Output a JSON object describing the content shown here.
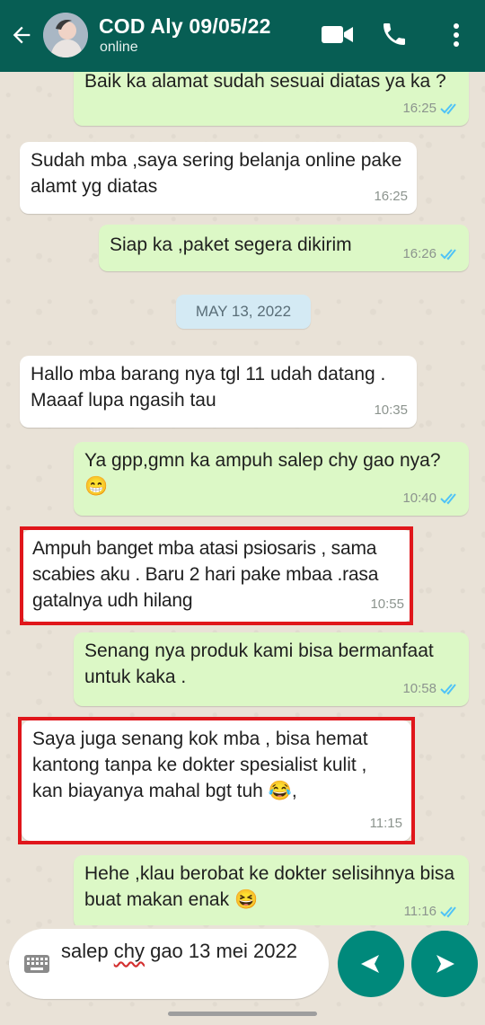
{
  "header": {
    "contact_name": "COD Aly 09/05/22",
    "status": "online",
    "bg_color": "#075e54"
  },
  "chat": {
    "date_separator": "MAY 13, 2022",
    "messages": [
      {
        "direction": "out",
        "text": "Baik ka alamat sudah sesuai diatas ya ka ?",
        "time": "16:25",
        "read": true
      },
      {
        "direction": "in",
        "text": "Sudah mba ,saya sering belanja online pake alamt yg diatas",
        "time": "16:25"
      },
      {
        "direction": "out",
        "text": "Siap ka ,paket segera dikirim",
        "time": "16:26",
        "read": true
      },
      {
        "direction": "in",
        "text": "Hallo mba barang nya tgl 11 udah datang . Maaaf lupa ngasih tau",
        "time": "10:35"
      },
      {
        "direction": "out",
        "text": "Ya gpp,gmn ka ampuh salep chy gao nya? 😁",
        "time": "10:40",
        "read": true
      },
      {
        "direction": "in",
        "text": "Ampuh banget mba atasi psiosaris , sama scabies aku . Baru 2 hari pake mbaa .rasa gatalnya udh hilang",
        "time": "10:55",
        "highlighted": true
      },
      {
        "direction": "out",
        "text": "Senang nya produk kami bisa bermanfaat untuk kaka .",
        "time": "10:58",
        "read": true
      },
      {
        "direction": "in",
        "text": "Saya juga senang kok mba , bisa hemat kantong tanpa ke dokter spesialist kulit , kan biayanya mahal bgt tuh 😂,",
        "time": "11:15",
        "highlighted": true
      },
      {
        "direction": "out",
        "text": "Hehe ,klau berobat ke dokter selisihnya bisa buat makan enak 😆",
        "time": "11:16",
        "read": true
      }
    ]
  },
  "composer": {
    "text_part1": "salep ",
    "text_misspelled": "chy",
    "text_part2": " gao 13 mei 2022"
  },
  "colors": {
    "outgoing_bubble": "#dcf8c6",
    "incoming_bubble": "#ffffff",
    "highlight_border": "#e0161b",
    "accent": "#00897b",
    "read_ticks": "#4fc3f7"
  },
  "icons": [
    "back-arrow-icon",
    "video-call-icon",
    "phone-icon",
    "more-menu-icon",
    "keyboard-icon",
    "read-ticks-icon",
    "prev-arrow-icon",
    "send-icon"
  ]
}
